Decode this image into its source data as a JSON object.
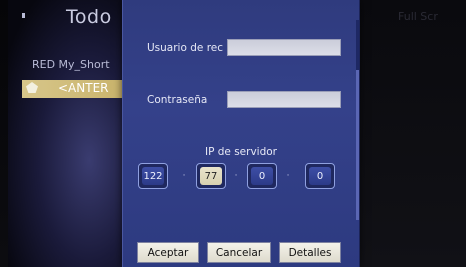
{
  "background": {
    "title": "Todo",
    "breadcrumb": "RED  My_Short",
    "selected_item": "<ANTER",
    "right_text": "Full Scr"
  },
  "dialog": {
    "user_label": "Usuario de rec",
    "user_value": "",
    "password_label": "Contraseña",
    "password_value": "",
    "ip_label": "IP de servidor",
    "ip_octets": [
      "122",
      "77",
      "0",
      "0"
    ],
    "ip_separator": "·",
    "buttons": {
      "accept": "Aceptar",
      "cancel": "Cancelar",
      "details": "Detalles"
    }
  },
  "colors": {
    "dialog_bg": "#34418a",
    "selected_row": "#d7c68a",
    "ip_active": "#e9e4cc"
  }
}
